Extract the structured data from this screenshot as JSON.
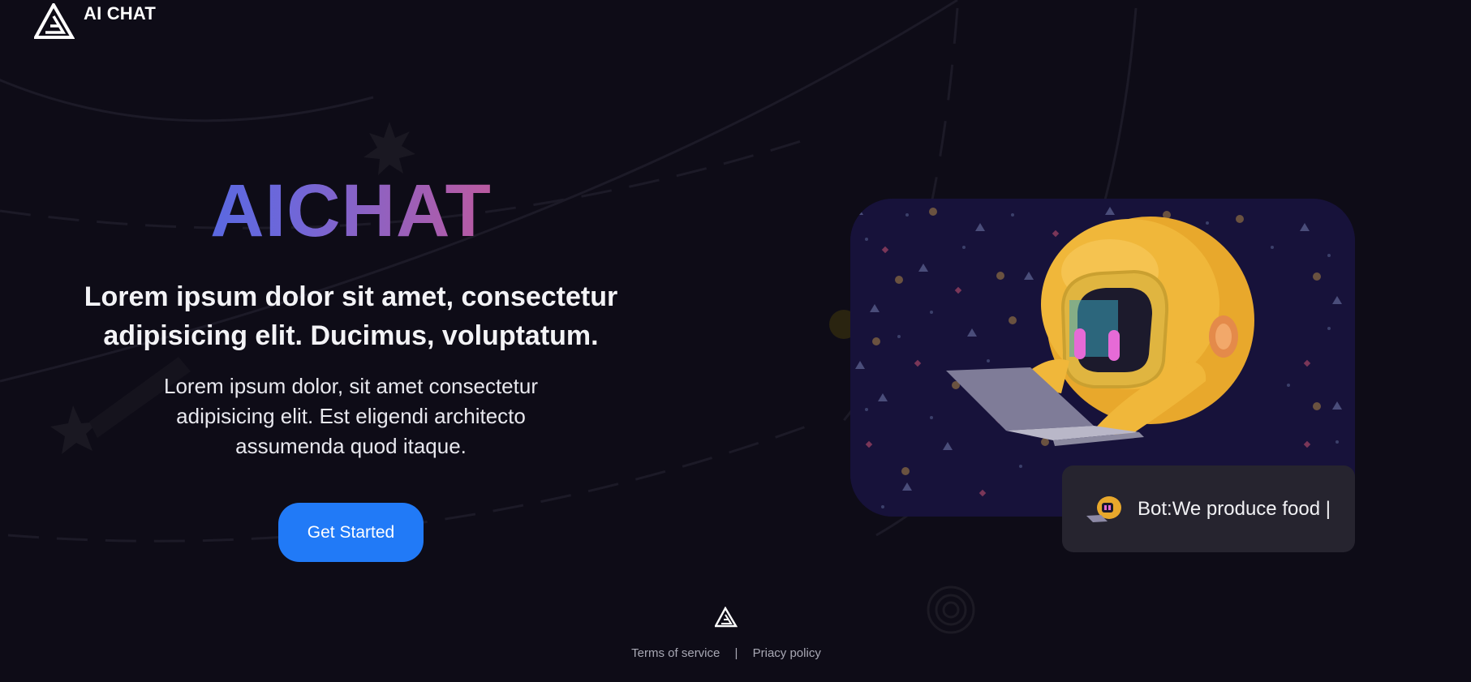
{
  "header": {
    "brand": "AI CHAT",
    "logo_icon": "triangle-logo-icon"
  },
  "hero": {
    "title": "AICHAT",
    "subtitle": "Lorem ipsum dolor sit amet, consectetur adipisicing elit. Ducimus, voluptatum.",
    "description": "Lorem ipsum dolor, sit amet consectetur adipisicing elit. Est eligendi architecto assumenda quod itaque.",
    "cta_label": "Get Started"
  },
  "media": {
    "illustration": "robot-with-laptop-illustration"
  },
  "chat": {
    "text": "Bot:We produce food |",
    "avatar": "robot-avatar-icon"
  },
  "footer": {
    "logo_icon": "triangle-logo-icon",
    "links": [
      {
        "label": "Terms of service"
      },
      {
        "label": "Priacy policy"
      }
    ],
    "separator": "|"
  },
  "colors": {
    "background": "#0e0c17",
    "accent": "#217af7",
    "gradient_start": "#2f6cf0",
    "gradient_end": "#e9556a",
    "bubble": "#26242f"
  }
}
